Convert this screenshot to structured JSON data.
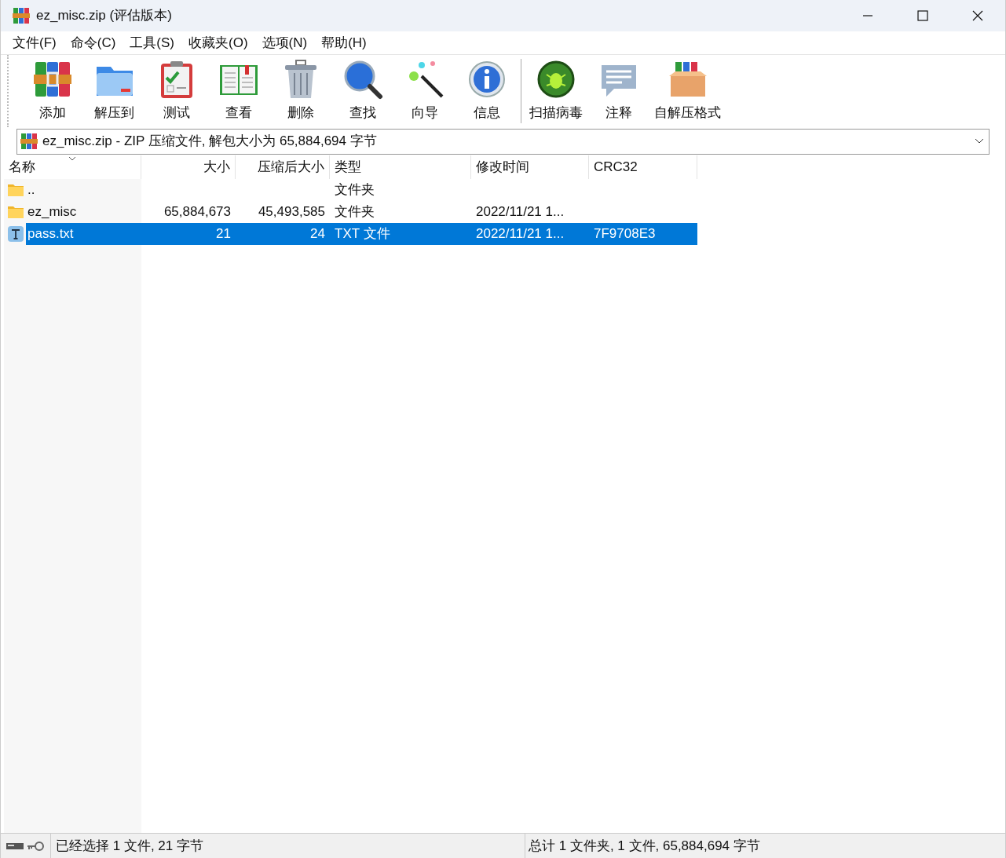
{
  "window": {
    "title": "ez_misc.zip (评估版本)"
  },
  "menu": [
    "文件(F)",
    "命令(C)",
    "工具(S)",
    "收藏夹(O)",
    "选项(N)",
    "帮助(H)"
  ],
  "toolbar": {
    "groups": [
      [
        {
          "label": "添加"
        },
        {
          "label": "解压到"
        },
        {
          "label": "测试"
        },
        {
          "label": "查看"
        },
        {
          "label": "删除"
        },
        {
          "label": "查找"
        },
        {
          "label": "向导"
        },
        {
          "label": "信息"
        }
      ],
      [
        {
          "label": "扫描病毒"
        },
        {
          "label": "注释"
        },
        {
          "label": "自解压格式"
        }
      ]
    ]
  },
  "address": {
    "text": "ez_misc.zip - ZIP 压缩文件, 解包大小为 65,884,694 字节"
  },
  "table": {
    "columns": [
      {
        "label": "名称",
        "sorted": true
      },
      {
        "label": "大小",
        "sorted": false
      },
      {
        "label": "压缩后大小",
        "sorted": false
      },
      {
        "label": "类型",
        "sorted": false
      },
      {
        "label": "修改时间",
        "sorted": false
      },
      {
        "label": "CRC32",
        "sorted": false
      }
    ],
    "rows": [
      {
        "kind": "folder",
        "selected": false,
        "cells": [
          "..",
          "",
          "",
          "文件夹",
          "",
          ""
        ]
      },
      {
        "kind": "folder",
        "selected": false,
        "cells": [
          "ez_misc",
          "65,884,673",
          "45,493,585",
          "文件夹",
          "2022/11/21 1...",
          ""
        ]
      },
      {
        "kind": "text",
        "selected": true,
        "cells": [
          "pass.txt",
          "21",
          "24",
          "TXT 文件",
          "2022/11/21 1...",
          "7F9708E3"
        ]
      }
    ]
  },
  "status_bar": {
    "left": "已经选择 1 文件, 21 字节",
    "right": "总计 1 文件夹, 1 文件, 65,884,694 字节"
  }
}
